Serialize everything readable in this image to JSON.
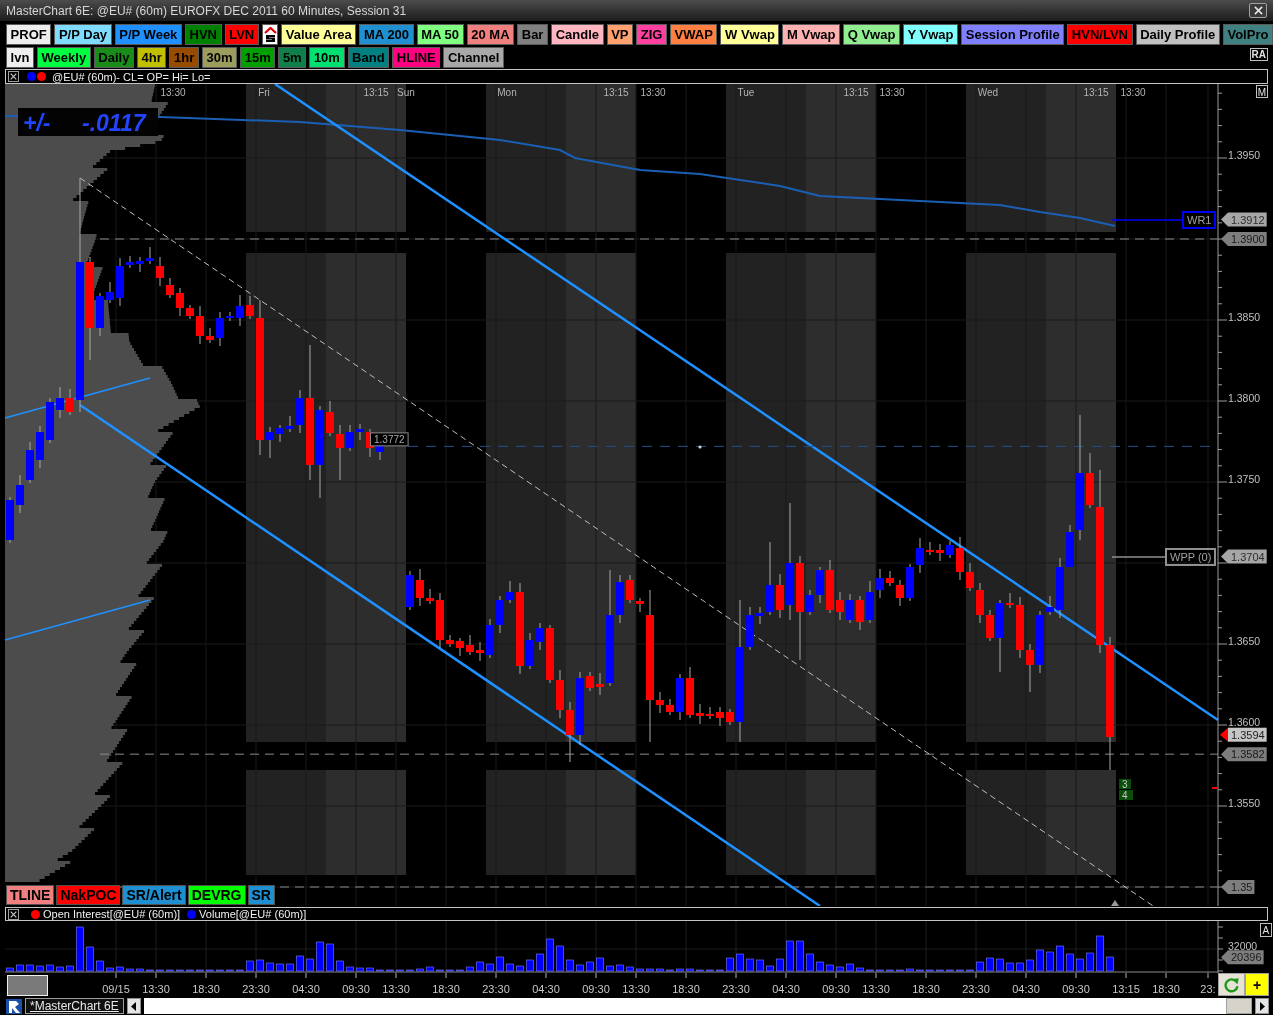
{
  "window": {
    "title": "MasterChart 6E: @EU# (60m) EUROFX DEC 2011 60 Minutes, Session 31"
  },
  "toolbars": [
    {
      "buttons": [
        {
          "kind": "text",
          "label": "PROF",
          "color": "#eeeeee"
        },
        {
          "kind": "text",
          "label": "P/P Day",
          "color": "#7fdcff"
        },
        {
          "kind": "text",
          "label": "P/P Week",
          "color": "#1e90ff"
        },
        {
          "kind": "text",
          "label": "HVN",
          "color": "#008000"
        },
        {
          "kind": "text",
          "label": "LVN",
          "color": "#ff0000"
        },
        {
          "kind": "icon",
          "color": "#ffffff"
        },
        {
          "kind": "text",
          "label": "Value Area",
          "color": "#ffff99"
        },
        {
          "kind": "text",
          "label": "MA 200",
          "color": "#2090d0"
        },
        {
          "kind": "text",
          "label": "MA 50",
          "color": "#80ff80"
        },
        {
          "kind": "text",
          "label": "20 MA",
          "color": "#f08080"
        },
        {
          "kind": "text",
          "label": "Bar",
          "color": "#808080"
        },
        {
          "kind": "text",
          "label": "Candle",
          "color": "#ffb6c1"
        },
        {
          "kind": "text",
          "label": "VP",
          "color": "#ffa070"
        },
        {
          "kind": "text",
          "label": "ZIG",
          "color": "#ff40a0"
        },
        {
          "kind": "text",
          "label": "VWAP",
          "color": "#ff8040"
        },
        {
          "kind": "text",
          "label": "W Vwap",
          "color": "#ffff99"
        },
        {
          "kind": "text",
          "label": "M Vwap",
          "color": "#ffb0b0"
        },
        {
          "kind": "text",
          "label": "Q Vwap",
          "color": "#90ee90"
        },
        {
          "kind": "text",
          "label": "Y Vwap",
          "color": "#80ffff"
        },
        {
          "kind": "text",
          "label": "Session Profile",
          "color": "#8080ff"
        },
        {
          "kind": "text",
          "label": "HVN/LVN",
          "color": "#ff0000"
        },
        {
          "kind": "text",
          "label": "Daily Profile",
          "color": "#c0c0c0"
        },
        {
          "kind": "text",
          "label": "VolPro",
          "color": "#408080"
        }
      ]
    },
    {
      "buttons": [
        {
          "kind": "text",
          "label": "lvn",
          "color": "#eeeeee"
        },
        {
          "kind": "text",
          "label": "Weekly",
          "color": "#00ff40"
        },
        {
          "kind": "text",
          "label": "Daily",
          "color": "#1a8c1a"
        },
        {
          "kind": "text",
          "label": "4hr",
          "color": "#c0c000"
        },
        {
          "kind": "text",
          "label": "1hr",
          "color": "#964b00"
        },
        {
          "kind": "text",
          "label": "30m",
          "color": "#9c9c5c"
        },
        {
          "kind": "text",
          "label": "15m",
          "color": "#00a000"
        },
        {
          "kind": "text",
          "label": "5m",
          "color": "#10804a"
        },
        {
          "kind": "text",
          "label": "10m",
          "color": "#00e070"
        },
        {
          "kind": "text",
          "label": "Band",
          "color": "#008080"
        },
        {
          "kind": "text",
          "label": "HLINE",
          "color": "#ff0080"
        },
        {
          "kind": "text",
          "label": "Channel",
          "color": "#a8a8a8"
        }
      ],
      "tag": "RA"
    }
  ],
  "price_pane": {
    "legend": {
      "dots": [
        {
          "color": "#0000ff"
        },
        {
          "color": "#ff0000"
        }
      ],
      "text": "@EU# (60m)- CL= OP= Hi= Lo="
    },
    "corner_tag": "M",
    "time_labels": [
      "13:30",
      "Fri",
      "13:15",
      "Sun",
      "Mon",
      "13:15",
      "13:30",
      "Tue",
      "13:15",
      "13:30",
      "Wed",
      "13:15",
      "13:30"
    ],
    "readout": {
      "label": "+/-",
      "value": "-.0117"
    },
    "price_tag": "1.3772",
    "axis_labels": [
      "1.3950",
      "1.3850",
      "1.3800",
      "1.3750",
      "1.3650",
      "1.3600",
      "1.3550"
    ],
    "flags": [
      {
        "value": "1.3912",
        "kind": "pivot"
      },
      {
        "value": "1.3900",
        "kind": "level"
      },
      {
        "value": "1.3704",
        "kind": "pivot"
      },
      {
        "value": "1.3594",
        "kind": "last"
      },
      {
        "value": "1.3582",
        "kind": "level"
      },
      {
        "value": "1.35",
        "kind": "level"
      }
    ],
    "level_tags": [
      {
        "label": "WR1",
        "color": "#0000ff"
      },
      {
        "label": "WPP (0)",
        "color": "#909090"
      }
    ],
    "count_badges": [
      "3",
      "4"
    ],
    "buttons": [
      {
        "label": "TLINE",
        "color": "#f08080"
      },
      {
        "label": "NakPOC",
        "color": "#ff0000"
      },
      {
        "label": "SR/Alert",
        "color": "#1e8fd0"
      },
      {
        "label": "DEVRG",
        "color": "#00ff00"
      },
      {
        "label": "SR",
        "color": "#1e8fd0"
      }
    ]
  },
  "volume_pane": {
    "legend": [
      {
        "label": "Open Interest[@EU# (60m)]",
        "color": "#ff0000"
      },
      {
        "label": "Volume[@EU# (60m)]",
        "color": "#0000ff"
      }
    ],
    "corner_tag": "A",
    "axis_labels": [
      "32000"
    ],
    "flags": [
      "20396"
    ]
  },
  "time_axis": {
    "labels": [
      "09/15",
      "13:30",
      "18:30",
      "23:30",
      "04:30",
      "09:30",
      "13:30",
      "18:30",
      "23:30",
      "04:30",
      "09:30",
      "13:30",
      "18:30",
      "23:30",
      "04:30",
      "09:30",
      "13:30",
      "18:30",
      "23:30",
      "04:30",
      "09:30",
      "13:15",
      "18:30",
      "23:"
    ],
    "add_label": "+"
  },
  "tab_bar": {
    "tabs": [
      {
        "label": "*MasterChart 6E",
        "selected": true
      }
    ]
  }
}
